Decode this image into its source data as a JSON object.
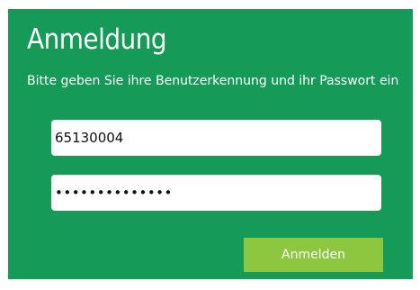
{
  "login": {
    "title": "Anmeldung",
    "instructions": "Bitte geben Sie ihre Benutzerkennung und ihr Passwort ein",
    "username_value": "65130004",
    "password_value": "••••••••••••••",
    "submit_label": "Anmelden"
  },
  "colors": {
    "panel_background": "#159a58",
    "button_background": "#8dc63f",
    "text": "#ffffff"
  }
}
